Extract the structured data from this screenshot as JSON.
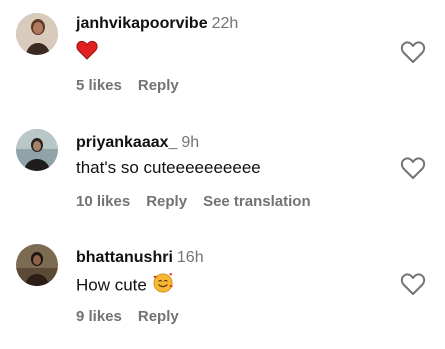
{
  "comments": [
    {
      "username": "janhvikapoorvibe",
      "time": "22h",
      "text": "",
      "emoji": "red-heart",
      "likes": "5 likes",
      "reply": "Reply",
      "translation": ""
    },
    {
      "username": "priyankaaax_",
      "time": "9h",
      "text": "that's so cuteeeeeeeeee",
      "emoji": "",
      "likes": "10 likes",
      "reply": "Reply",
      "translation": "See translation"
    },
    {
      "username": "bhattanushri",
      "time": "16h",
      "text": "How cute",
      "emoji": "smiling-face-with-hearts",
      "likes": "9 likes",
      "reply": "Reply",
      "translation": ""
    }
  ],
  "colors": {
    "meta_gray": "#737373",
    "heart_red": "#e0201e",
    "emoji_yellow": "#f7b733"
  },
  "icons": {
    "like": "heart-outline-icon"
  }
}
